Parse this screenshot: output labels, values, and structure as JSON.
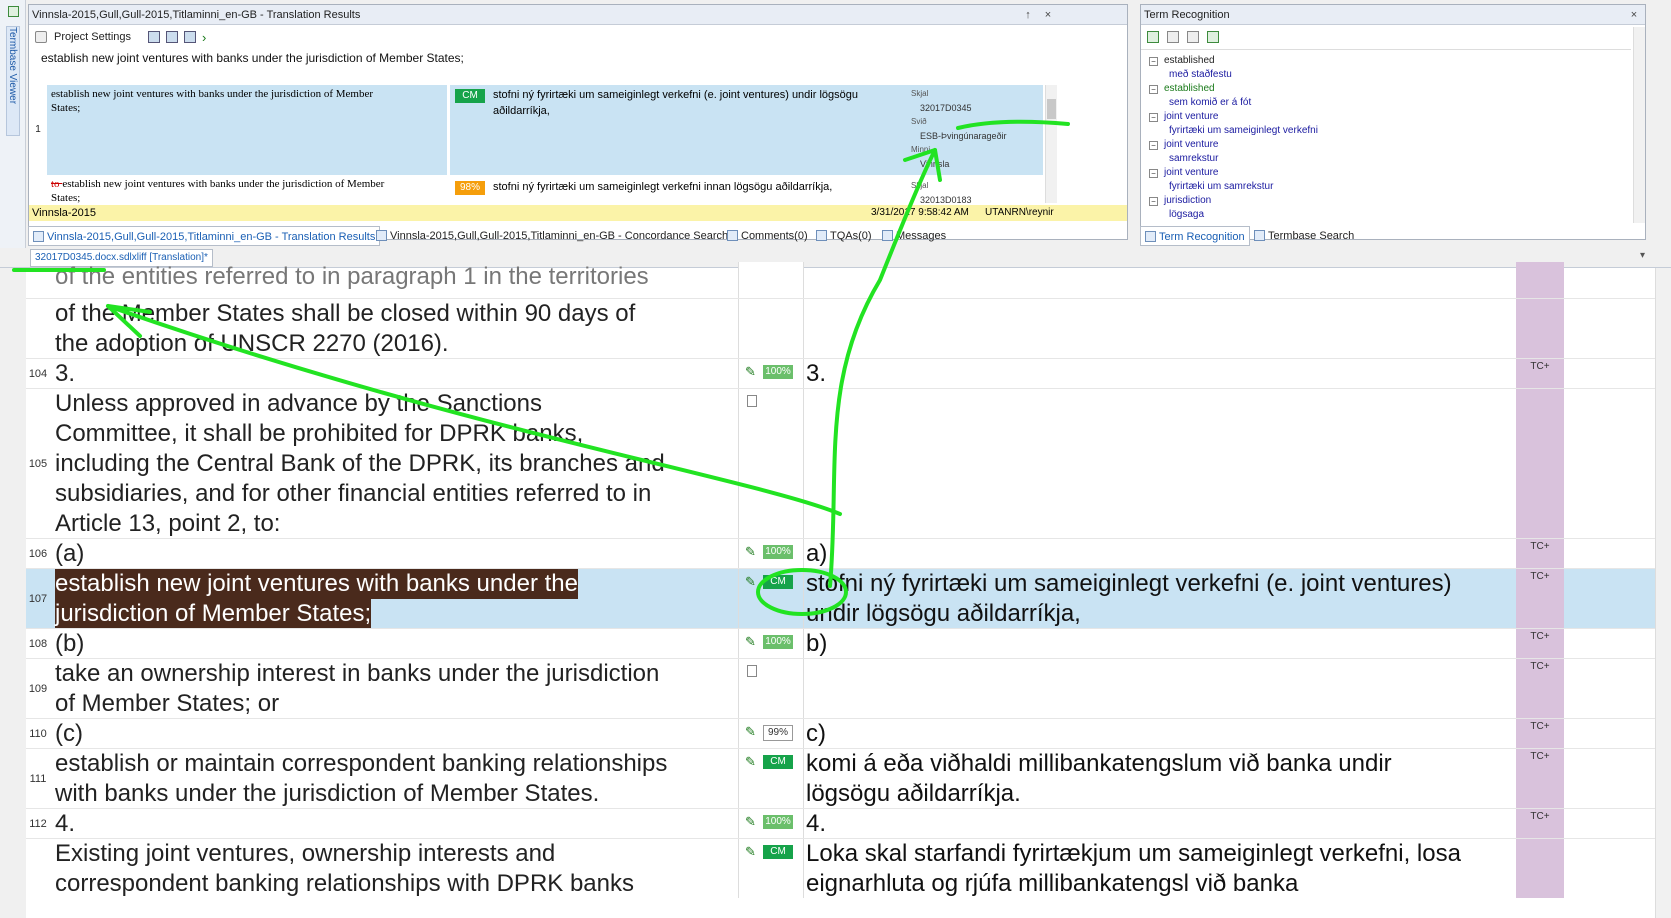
{
  "sidebar": {
    "label": "Termbase Viewer"
  },
  "translation_results": {
    "title": "Vinnsla-2015,Gull,Gull-2015,Titlaminni_en-GB - Translation Results",
    "pin": "↑",
    "close": "×",
    "toolbar": {
      "project_settings": "Project Settings"
    },
    "source": "establish new joint ventures with banks under the jurisdiction of Member States;",
    "hits": [
      {
        "index": "1",
        "source_line1": "establish new joint ventures with banks under the jurisdiction of Member",
        "source_line2": "States;",
        "match": "CM",
        "target": "stofni ný fyrirtæki um sameiginlegt verkefni (e. joint ventures) undir lögsögu aðildarríkja,",
        "skjal_label": "Skjal",
        "skjal_value": "32017D0345",
        "svid_label": "Svið",
        "svid_value": "ESB-Þvingúnarageðir",
        "minni_label": "Minni",
        "minni_value": "Vinnsla"
      },
      {
        "source_deleted": "to ",
        "source_line1": "establish new joint ventures with banks under the jurisdiction of Member",
        "source_line2": "States;",
        "match": "98%",
        "target": "stofni ný fyrirtæki um sameiginlegt verkefni innan lögsögu aðildarríkja,",
        "skjal_label": "Skjal",
        "skjal_value": "32013D0183"
      }
    ],
    "status": {
      "memory": "Vinnsla-2015",
      "date": "3/31/2017 9:58:42 AM",
      "user": "UTANRN\\reynir"
    }
  },
  "bottom_tabs": {
    "tab1": "Vinnsla-2015,Gull,Gull-2015,Titlaminni_en-GB - Translation Results",
    "tab2": "Vinnsla-2015,Gull,Gull-2015,Titlaminni_en-GB - Concordance Search",
    "tab3": "Comments(0)",
    "tab4": "TQAs(0)",
    "tab5": "Messages",
    "tab6": "Term Recognition",
    "tab7": "Termbase Search"
  },
  "term_recognition": {
    "title": "Term Recognition",
    "close": "×",
    "collapse": "−",
    "terms": [
      {
        "source": "established",
        "target": "með staðfestu",
        "source_color": "#222222"
      },
      {
        "source": "established",
        "target": "sem komið er á fót",
        "source_color": "#1a7a1a"
      },
      {
        "source": "joint venture",
        "target": "fyrirtæki um sameiginlegt verkefni",
        "source_color": "#1a7a1a"
      },
      {
        "source": "joint venture",
        "target": "samrekstur",
        "source_color": "#1a7a1a"
      },
      {
        "source": "joint venture",
        "target": "fyrirtæki um samrekstur",
        "source_color": "#1a7a1a"
      },
      {
        "source": "jurisdiction",
        "target": "lögsaga",
        "source_color": "#1a7a1a"
      }
    ]
  },
  "doc_tab": "32017D0345.docx.sdlxliff [Translation]*",
  "editor": {
    "partial_top": "of the entities referred to in paragraph 1 in the territories",
    "rows": [
      {
        "num": "",
        "src": [
          "of the Member States shall be closed within 90 days of",
          "the adoption of UNSCR 2270 (2016)."
        ],
        "tgt": [],
        "match": "",
        "status": ""
      },
      {
        "num": "104",
        "src": [
          "3."
        ],
        "tgt": [
          "3."
        ],
        "match": "100%",
        "status": "TC+"
      },
      {
        "num": "105",
        "src": [
          "Unless approved in advance by the Sanctions",
          "Committee, it shall be prohibited for DPRK banks,",
          "including the Central Bank of the DPRK, its branches and",
          "subsidiaries, and for other financial entities referred to in",
          "Article 13, point 2, to:"
        ],
        "tgt": [],
        "match": "",
        "status": ""
      },
      {
        "num": "106",
        "src": [
          "(a)"
        ],
        "tgt": [
          "a)"
        ],
        "match": "100%",
        "status": "TC+"
      },
      {
        "num": "107",
        "src": [
          "establish new joint ventures with banks under the",
          "jurisdiction of Member States;"
        ],
        "tgt": [
          "stofni ný fyrirtæki um sameiginlegt verkefni (e. joint ventures)",
          "undir lögsögu aðildarríkja,"
        ],
        "match": "CM",
        "status": "TC+"
      },
      {
        "num": "108",
        "src": [
          "(b)"
        ],
        "tgt": [
          "b)"
        ],
        "match": "100%",
        "status": "TC+"
      },
      {
        "num": "109",
        "src": [
          "take an ownership interest in banks under the jurisdiction",
          "of Member States; or"
        ],
        "tgt": [],
        "match": "",
        "status": "TC+"
      },
      {
        "num": "110",
        "src": [
          "(c)"
        ],
        "tgt": [
          "c)"
        ],
        "match": "99%",
        "status": "TC+"
      },
      {
        "num": "111",
        "src": [
          "establish or maintain correspondent banking relationships",
          "with banks under the jurisdiction of Member States."
        ],
        "tgt": [
          "komi á eða viðhaldi millibankatengslum við banka undir",
          "lögsögu aðildarríkja."
        ],
        "match": "CM",
        "status": "TC+"
      },
      {
        "num": "112",
        "src": [
          "4."
        ],
        "tgt": [
          "4."
        ],
        "match": "100%",
        "status": "TC+"
      },
      {
        "num": "",
        "src": [
          "Existing joint ventures, ownership interests and",
          "correspondent banking relationships with DPRK banks"
        ],
        "tgt": [
          "Loka skal starfandi fyrirtækjum um sameiginlegt verkefni, losa",
          "eignarhluta og rjúfa millibankatengsl við banka"
        ],
        "match": "CM",
        "status": ""
      }
    ]
  },
  "colors": {
    "cm": "#16a34a",
    "pct100": "#6bbf6b",
    "pct98": "#f59e0b",
    "annotation": "#22e322",
    "selected": "#c9e3f3",
    "srchl": "#4a2a1c"
  }
}
